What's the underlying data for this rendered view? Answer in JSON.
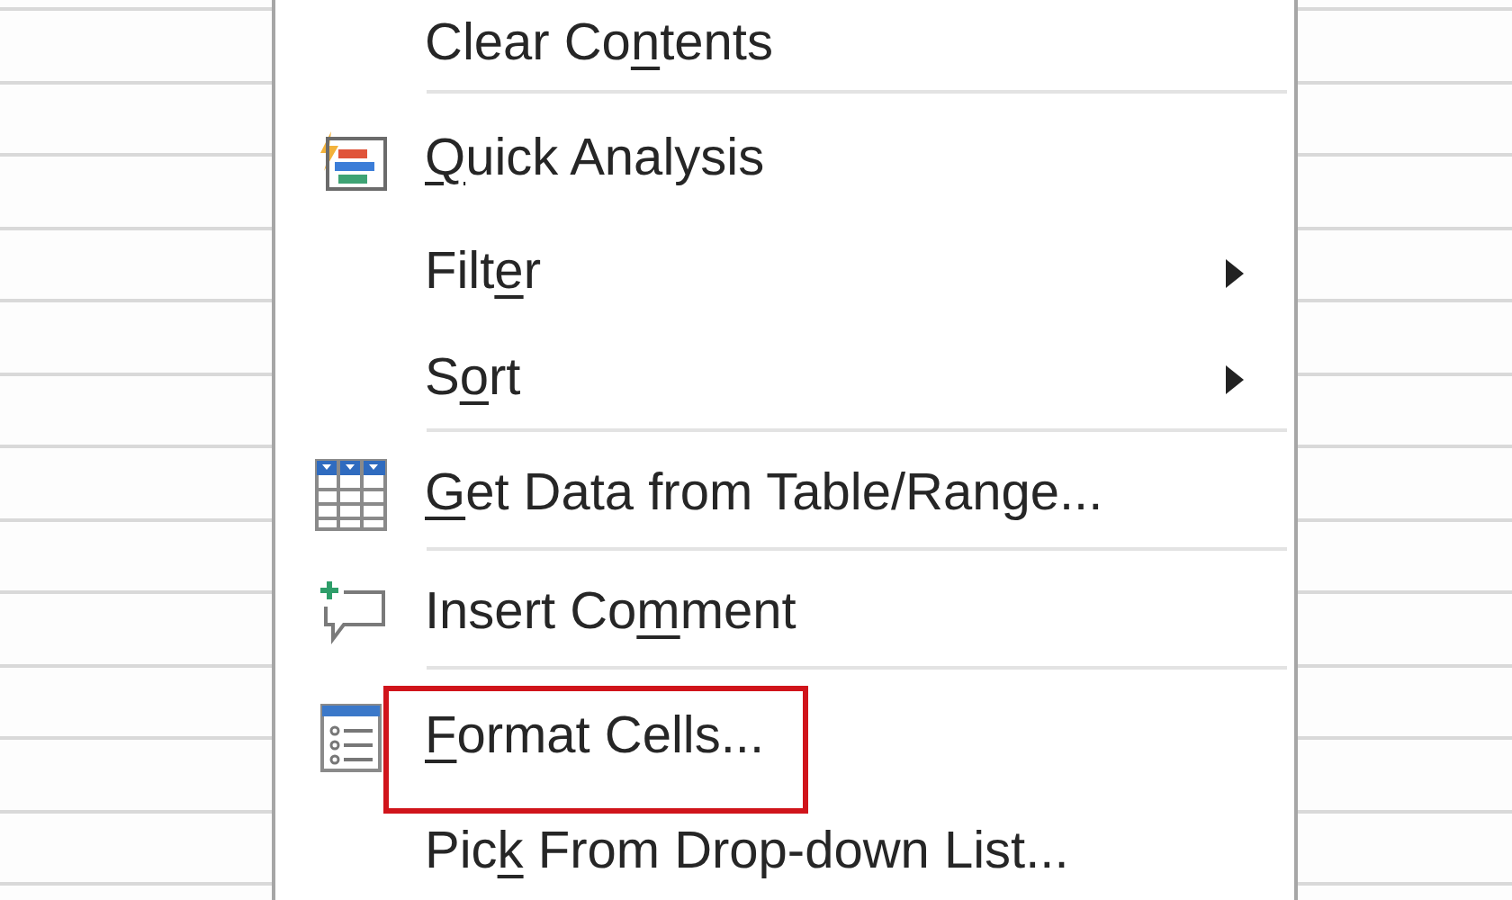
{
  "context_menu": {
    "items": [
      {
        "label": {
          "before": "Clear Co",
          "key": "n",
          "after": "tents"
        },
        "kind": "plain",
        "submenu": false,
        "separator_after": true,
        "highlighted": false
      },
      {
        "label": {
          "key": "Q",
          "after": "uick Analysis"
        },
        "kind": "analysis",
        "submenu": false,
        "separator_after": false,
        "highlighted": false
      },
      {
        "label": {
          "before": "Filt",
          "key": "e",
          "after": "r"
        },
        "kind": "plain",
        "submenu": true,
        "separator_after": false,
        "highlighted": false
      },
      {
        "label": {
          "before": "S",
          "key": "o",
          "after": "rt"
        },
        "kind": "plain",
        "submenu": true,
        "separator_after": true,
        "highlighted": false
      },
      {
        "label": {
          "key": "G",
          "after": "et Data from Table/Range..."
        },
        "kind": "table",
        "submenu": false,
        "separator_after": true,
        "highlighted": false
      },
      {
        "label": {
          "before": "Insert Co",
          "key": "m",
          "after": "ment"
        },
        "kind": "comment",
        "submenu": false,
        "separator_after": true,
        "highlighted": false
      },
      {
        "label": {
          "key": "F",
          "after": "ormat Cells..."
        },
        "kind": "format",
        "submenu": false,
        "separator_after": false,
        "highlighted": true
      },
      {
        "label": {
          "before": "Pic",
          "key": "k",
          "after": " From Drop-down List..."
        },
        "kind": "plain",
        "submenu": false,
        "separator_after": false,
        "highlighted": false
      }
    ]
  }
}
